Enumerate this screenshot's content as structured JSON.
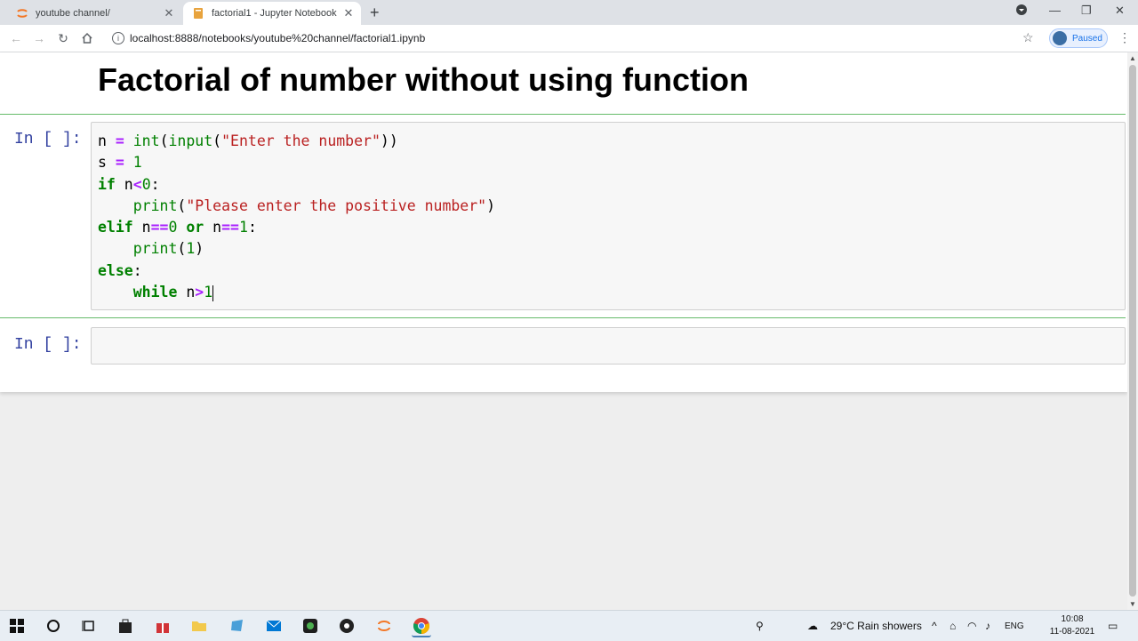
{
  "browser": {
    "tabs": [
      {
        "title": "youtube channel/",
        "active": false,
        "icon": "jupyter-icon"
      },
      {
        "title": "factorial1 - Jupyter Notebook",
        "active": true,
        "icon": "notebook-icon"
      }
    ],
    "url": "localhost:8888/notebooks/youtube%20channel/factorial1.ipynb",
    "profile_label": "Paused"
  },
  "notebook": {
    "markdown_title": "Factorial of number without using function",
    "cells": [
      {
        "prompt": "In [ ]:",
        "code_lines": [
          "n = int(input(\"Enter the number\"))",
          "s = 1",
          "if n<0:",
          "    print(\"Please enter the positive number\")",
          "elif n==0 or n==1:",
          "    print(1)",
          "else:",
          "    while n>1"
        ]
      },
      {
        "prompt": "In [ ]:",
        "code_lines": []
      }
    ]
  },
  "taskbar": {
    "weather": "29°C  Rain showers",
    "language": "ENG",
    "time": "10:08",
    "date": "11-08-2021"
  },
  "colors": {
    "keyword": "#008000",
    "operator": "#aa22ff",
    "string": "#ba2121",
    "prompt": "#303f9f",
    "cell_border_selected": "#66bb6a"
  }
}
